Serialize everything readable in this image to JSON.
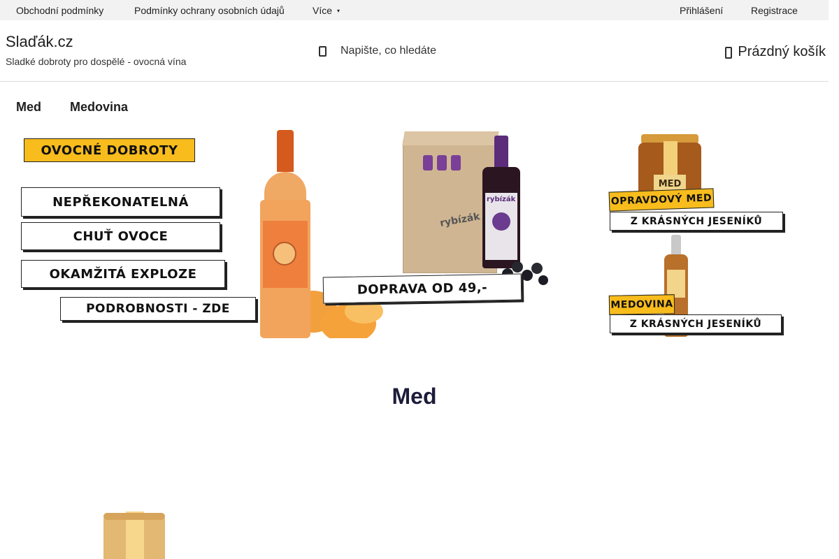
{
  "topbar": {
    "links": [
      "Obchodní podmínky",
      "Podmínky ochrany osobních údajů",
      "Více"
    ],
    "more_caret": "▾",
    "login": "Přihlášení",
    "register": "Registrace"
  },
  "header": {
    "logo": "Slaďák.cz",
    "tagline": "Sladké dobroty pro dospělé - ovocná vína",
    "search_placeholder": "Napište, co hledáte",
    "cart_label": "Prázdný košík"
  },
  "category_nav": {
    "items": [
      "Med",
      "Medovina"
    ]
  },
  "banner": {
    "heading": "OVOCNÉ DOBROTY",
    "lines": [
      "NEPŘEKONATELNÁ",
      "CHUŤ OVOCE",
      "OKAMŽITÁ EXPLOZE"
    ],
    "details": "PODROBNOSTI - ZDE",
    "shipping": "DOPRAVA OD 49,-",
    "box_brand": "rybízák",
    "bottle_brand": "rybízák"
  },
  "side_banner": {
    "jar_label": "MED",
    "honey_title": "OPRAVDOVÝ MED",
    "honey_sub": "Z KRÁSNÝCH JESENÍKŮ",
    "mead_title": "MEDOVINA",
    "mead_sub": "Z KRÁSNÝCH JESENÍKŮ"
  },
  "section": {
    "title": "Med"
  },
  "colors": {
    "topbar_bg": "#f2f2f2",
    "accent_yellow": "#f8bc1c",
    "title_color": "#1d1d3a"
  }
}
